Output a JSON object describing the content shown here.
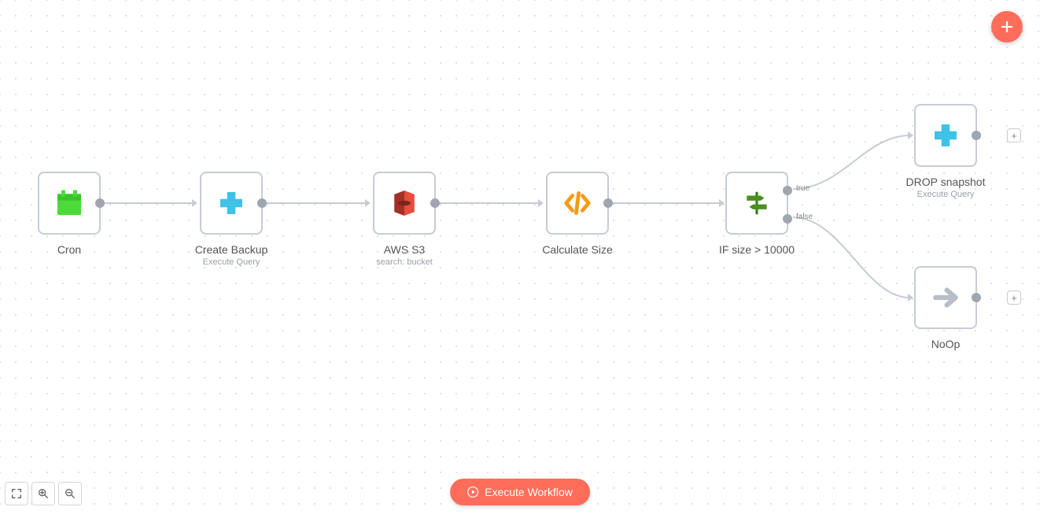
{
  "workflow": {
    "nodes": {
      "cron": {
        "label": "Cron",
        "sublabel": ""
      },
      "backup": {
        "label": "Create Backup",
        "sublabel": "Execute Query"
      },
      "s3": {
        "label": "AWS S3",
        "sublabel": "search: bucket"
      },
      "calc": {
        "label": "Calculate Size",
        "sublabel": ""
      },
      "if": {
        "label": "IF size > 10000",
        "sublabel": "",
        "true_label": "true",
        "false_label": "false"
      },
      "drop": {
        "label": "DROP snapshot",
        "sublabel": "Execute Query"
      },
      "noop": {
        "label": "NoOp",
        "sublabel": ""
      }
    }
  },
  "buttons": {
    "execute": "Execute Workflow"
  },
  "icons": {
    "add": "+",
    "port_add": "+"
  }
}
